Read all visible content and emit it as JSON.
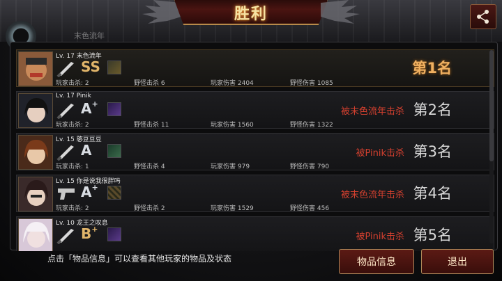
{
  "title": "胜利",
  "background_name": "末色流年",
  "share_icon": "share-icon",
  "players": [
    {
      "level": "Lv. 17",
      "name": "末色流年",
      "weapon": "knife-icon",
      "grade": "SS",
      "grade_plus": "",
      "player_kills_label": "玩家击杀: 2",
      "monster_kills_label": "野怪击杀 6",
      "player_damage_label": "玩家伤害 2404",
      "monster_damage_label": "野怪伤害 1085",
      "killed_by": "",
      "rank": "第1名"
    },
    {
      "level": "Lv. 17",
      "name": "Pinik",
      "weapon": "knife-icon",
      "grade": "A",
      "grade_plus": "+",
      "player_kills_label": "玩家击杀: 2",
      "monster_kills_label": "野怪击杀 11",
      "player_damage_label": "玩家伤害 1560",
      "monster_damage_label": "野怪伤害 1322",
      "killed_by": "被末色流年击杀",
      "rank": "第2名"
    },
    {
      "level": "Lv. 15",
      "name": "憨豆豆豆",
      "weapon": "knife-icon",
      "grade": "A",
      "grade_plus": "",
      "player_kills_label": "玩家击杀: 1",
      "monster_kills_label": "野怪击杀 4",
      "player_damage_label": "玩家伤害 979",
      "monster_damage_label": "野怪伤害 790",
      "killed_by": "被Pinik击杀",
      "rank": "第3名"
    },
    {
      "level": "Lv. 15",
      "name": "你是说我很胖吗",
      "weapon": "pistol-icon",
      "grade": "A",
      "grade_plus": "+",
      "player_kills_label": "玩家击杀: 2",
      "monster_kills_label": "野怪击杀 2",
      "player_damage_label": "玩家伤害 1529",
      "monster_damage_label": "野怪伤害 456",
      "killed_by": "被末色流年击杀",
      "rank": "第4名"
    },
    {
      "level": "Lv. 10",
      "name": "龙王之叹息",
      "weapon": "knife-icon",
      "grade": "B",
      "grade_plus": "+",
      "player_kills_label": "",
      "monster_kills_label": "",
      "player_damage_label": "",
      "monster_damage_label": "",
      "killed_by": "被Pinik击杀",
      "rank": "第5名"
    }
  ],
  "hint": "点击「物品信息」可以查看其他玩家的物品及状态",
  "buttons": {
    "item_info": "物品信息",
    "exit": "退出"
  },
  "colors": {
    "killed_text": "#d4402f",
    "rank_first": "#f0b060",
    "button_bg": "#4a1411",
    "button_border": "#b08a5a"
  }
}
